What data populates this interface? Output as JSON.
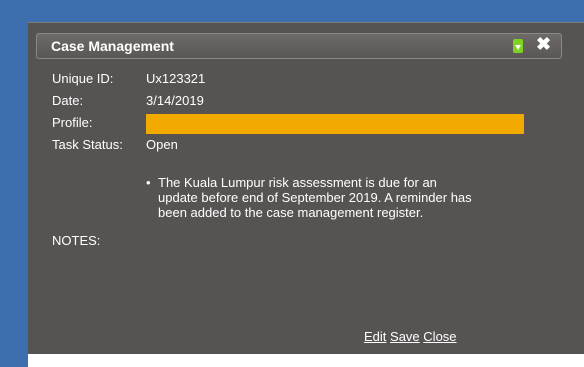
{
  "window": {
    "title": "Case Management",
    "download_icon": "download-icon",
    "close_icon": "close-icon",
    "close_glyph": "✖"
  },
  "fields": {
    "unique_id_label": "Unique ID:",
    "unique_id_value": "Ux123321",
    "date_label": "Date:",
    "date_value": "3/14/2019",
    "profile_label": "Profile:",
    "task_status_label": "Task Status:",
    "task_status_value": "Open"
  },
  "notes": {
    "label": "NOTES:",
    "items": [
      "The Kuala Lumpur risk assessment is due for an update before end of September 2019. A reminder has been added to the case management register."
    ]
  },
  "actions": {
    "edit": "Edit",
    "save": "Save",
    "close": "Close"
  },
  "colors": {
    "frame": "#3d6fae",
    "panel": "#575352",
    "profile_highlight": "#f2a900",
    "download_icon": "#7ed321"
  }
}
